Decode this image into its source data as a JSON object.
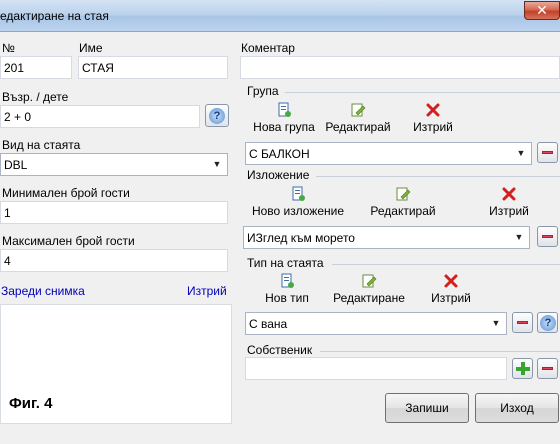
{
  "window": {
    "title": "едактиране на стая",
    "close_glyph": "✕"
  },
  "fields": {
    "number_label": "№",
    "number_value": "201",
    "name_label": "Име",
    "name_value": "СТАЯ",
    "age_label": "Възр. / дете",
    "age_value": "2 + 0",
    "room_type_label": "Вид на стаята",
    "room_type_value": "DBL",
    "min_guests_label": "Минимален брой гости",
    "min_guests_value": "1",
    "max_guests_label": "Максимален брой гости",
    "max_guests_value": "4",
    "comment_label": "Коментар",
    "comment_value": ""
  },
  "photo": {
    "load_label": "Зареди снимка",
    "delete_label": "Изтрий",
    "caption": "Фиг. 4"
  },
  "group": {
    "label": "Група",
    "new_label": "Нова група",
    "edit_label": "Редактирай",
    "delete_label": "Изтрий",
    "value": "С БАЛКОН"
  },
  "view": {
    "label": "Изложение",
    "new_label": "Ново изложение",
    "edit_label": "Редактирай",
    "delete_label": "Изтрий",
    "value": "ИЗглед към морето"
  },
  "room_kind": {
    "label": "Тип на стаята",
    "new_label": "Нов тип",
    "edit_label": "Редактиране",
    "delete_label": "Изтрий",
    "value": "С вана"
  },
  "owner": {
    "label": "Собственик",
    "value": ""
  },
  "buttons": {
    "save": "Запиши",
    "exit": "Изход"
  },
  "help_glyph": "?",
  "icons": [
    "new-icon",
    "edit-icon",
    "delete-icon",
    "help-icon",
    "plus-icon",
    "minus-icon",
    "dropdown-arrow-icon"
  ],
  "colors": {
    "link": "#0000b8",
    "delete_red": "#d41f1f",
    "plus_green": "#39a531"
  }
}
